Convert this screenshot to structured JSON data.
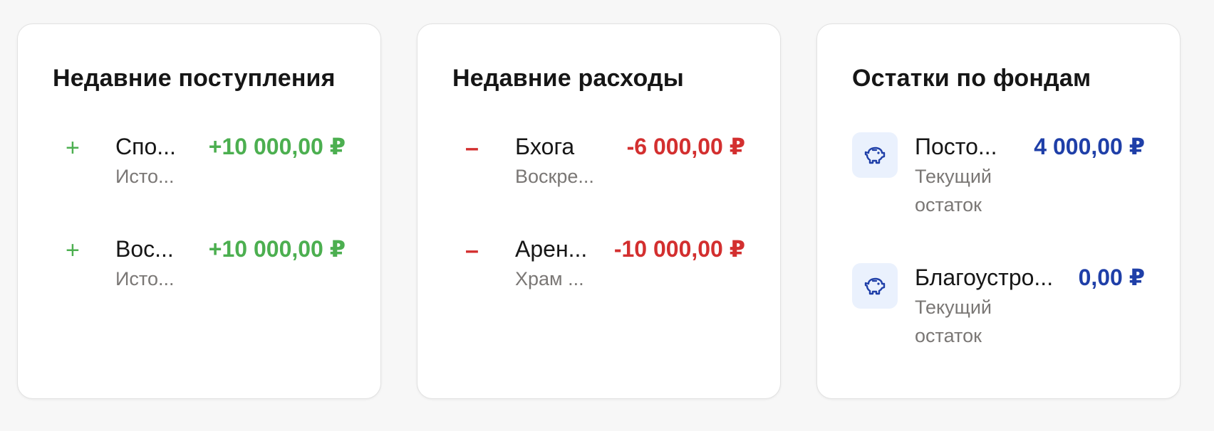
{
  "colors": {
    "income": "#4caf50",
    "expense": "#d32f2f",
    "fund": "#1f3fa8",
    "fund_icon_bg": "#eaf1fd"
  },
  "income": {
    "title": "Недавние поступления",
    "items": [
      {
        "sign": "+",
        "title": "Спо...",
        "subtitle": "Исто...",
        "amount": "+10 000,00 ₽"
      },
      {
        "sign": "+",
        "title": "Вос...",
        "subtitle": "Исто...",
        "amount": "+10 000,00 ₽"
      }
    ]
  },
  "expenses": {
    "title": "Недавние расходы",
    "items": [
      {
        "sign": "–",
        "title": "Бхога",
        "subtitle": "Воскре...",
        "amount": "-6 000,00 ₽"
      },
      {
        "sign": "–",
        "title": "Арен...",
        "subtitle": "Храм ...",
        "amount": "-10 000,00 ₽"
      }
    ]
  },
  "funds": {
    "title": "Остатки по фондам",
    "items": [
      {
        "icon": "piggy-bank-icon",
        "title": "Посто...",
        "subtitle": "Текущий остаток",
        "amount": "4 000,00 ₽"
      },
      {
        "icon": "piggy-bank-icon",
        "title": "Благоустро...",
        "subtitle": "Текущий остаток",
        "amount": "0,00 ₽"
      }
    ]
  }
}
